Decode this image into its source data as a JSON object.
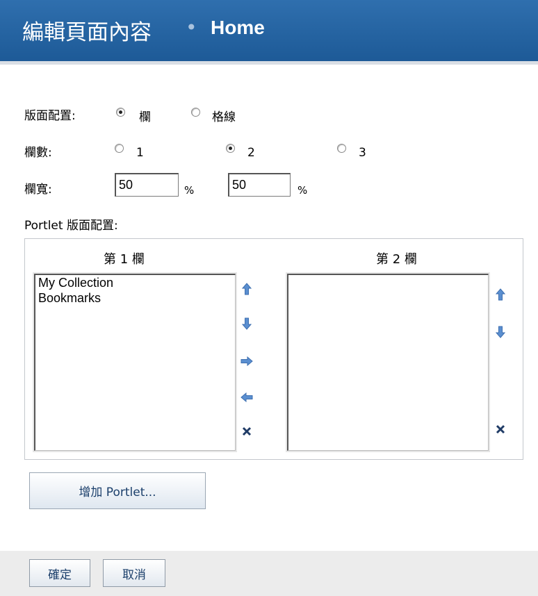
{
  "header": {
    "title": "編輯頁面內容",
    "separator": "•",
    "page_name": "Home"
  },
  "form": {
    "layout_label": "版面配置:",
    "layout_options": [
      "欄",
      "格線"
    ],
    "layout_selected": "欄",
    "columns_label": "欄數:",
    "columns_options": [
      "1",
      "2",
      "3"
    ],
    "columns_selected": "2",
    "width_label": "欄寬:",
    "width_values": [
      "50",
      "50"
    ],
    "width_unit": "%",
    "portlet_layout_label": "Portlet 版面配置:"
  },
  "columns": [
    {
      "header": "第 1 欄",
      "items": [
        "My Collection",
        "Bookmarks"
      ]
    },
    {
      "header": "第 2 欄",
      "items": []
    }
  ],
  "icons": {
    "up": "arrow-up-icon",
    "down": "arrow-down-icon",
    "right": "arrow-right-icon",
    "left": "arrow-left-icon",
    "remove": "close-icon"
  },
  "buttons": {
    "add_portlet": "增加 Portlet...",
    "ok": "確定",
    "cancel": "取消"
  },
  "colors": {
    "header_bg": "#1d5a97",
    "arrow_blue": "#5b8fd0",
    "remove_dark": "#1f3b66"
  }
}
